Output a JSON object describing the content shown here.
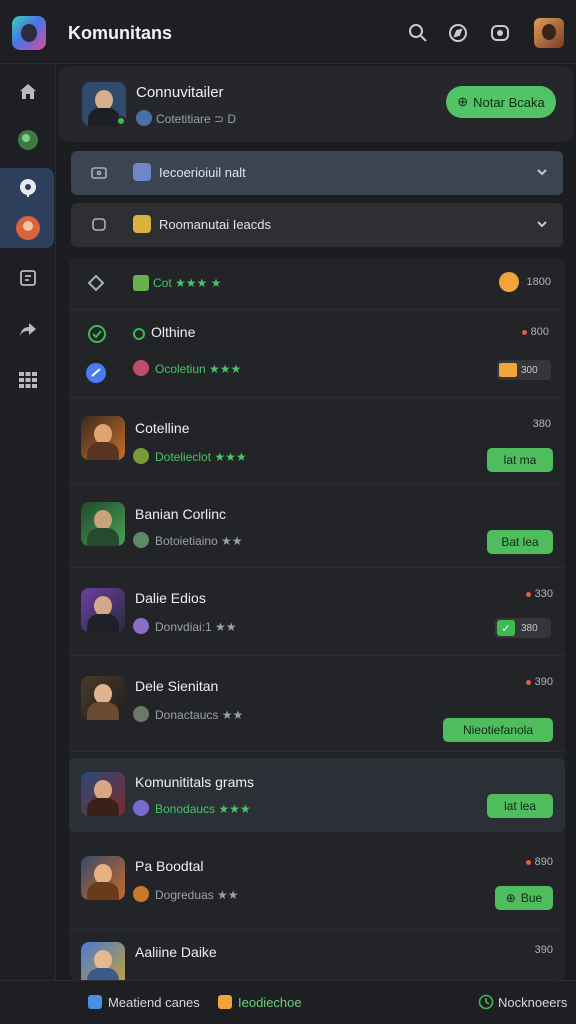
{
  "header": {
    "title": "Komunitans",
    "icons": [
      "app-logo",
      "search-icon",
      "compass-icon",
      "chat-icon",
      "profile-avatar"
    ]
  },
  "sidebar": {
    "icons": [
      "home-icon",
      "game-icon",
      "discover-icon",
      "avatar-icon",
      "clipboard-icon",
      "share-icon",
      "grid-icon"
    ]
  },
  "top_card": {
    "name": "Connuvitailer",
    "subtitle": "Cotetitiare ⊃ D",
    "button": "Notar Bcaka"
  },
  "dropdowns": [
    {
      "label": "Iecoerioiuil nalt"
    },
    {
      "label": "Roomanutai Ieacds"
    }
  ],
  "list": [
    {
      "name": "Cot ★★★ ★",
      "count": "1800"
    },
    {
      "name": "Olthine",
      "sub": "Ocoletiun ★★★",
      "count": "800",
      "badge": "300"
    },
    {
      "name": "Cotelline",
      "sub": "Dotelieclot ★★★",
      "count": "380",
      "button": "lat ma"
    },
    {
      "name": "Banian Corlinc",
      "sub": "Botoietiaino ★★",
      "count": "",
      "button": "Bat lea"
    },
    {
      "name": "Dalie Edios",
      "sub": "Donvdiai:1 ★★",
      "count": "330",
      "badge": "380"
    },
    {
      "name": "Dele Sienitan",
      "sub": "Donactaucs ★★",
      "count": "390",
      "button": "Nieotiefanola"
    },
    {
      "name": "Komunititals grams",
      "sub": "Bonodaucs ★★★",
      "count": "",
      "button": "lat lea"
    },
    {
      "name": "Pa Boodtal",
      "sub": "Dogreduas ★★",
      "count": "890",
      "button": "Bue"
    },
    {
      "name": "Aaliine Daike",
      "sub": "",
      "count": "390"
    }
  ],
  "bottom_bar": {
    "left": "Meatiend canes",
    "middle": "Ieodiechoe",
    "right": "Nocknoeers"
  },
  "colors": {
    "accent_green": "#4fbd5e",
    "highlight_blue": "#2d3f5a",
    "background": "#1c1d20"
  }
}
